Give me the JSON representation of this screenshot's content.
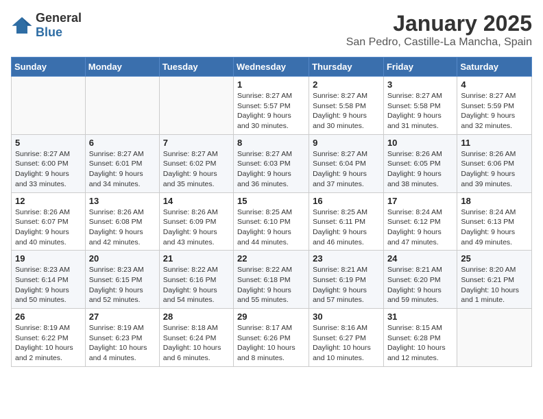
{
  "logo": {
    "general": "General",
    "blue": "Blue"
  },
  "header": {
    "month": "January 2025",
    "location": "San Pedro, Castille-La Mancha, Spain"
  },
  "weekdays": [
    "Sunday",
    "Monday",
    "Tuesday",
    "Wednesday",
    "Thursday",
    "Friday",
    "Saturday"
  ],
  "weeks": [
    [
      {
        "day": "",
        "info": ""
      },
      {
        "day": "",
        "info": ""
      },
      {
        "day": "",
        "info": ""
      },
      {
        "day": "1",
        "info": "Sunrise: 8:27 AM\nSunset: 5:57 PM\nDaylight: 9 hours\nand 30 minutes."
      },
      {
        "day": "2",
        "info": "Sunrise: 8:27 AM\nSunset: 5:58 PM\nDaylight: 9 hours\nand 30 minutes."
      },
      {
        "day": "3",
        "info": "Sunrise: 8:27 AM\nSunset: 5:58 PM\nDaylight: 9 hours\nand 31 minutes."
      },
      {
        "day": "4",
        "info": "Sunrise: 8:27 AM\nSunset: 5:59 PM\nDaylight: 9 hours\nand 32 minutes."
      }
    ],
    [
      {
        "day": "5",
        "info": "Sunrise: 8:27 AM\nSunset: 6:00 PM\nDaylight: 9 hours\nand 33 minutes."
      },
      {
        "day": "6",
        "info": "Sunrise: 8:27 AM\nSunset: 6:01 PM\nDaylight: 9 hours\nand 34 minutes."
      },
      {
        "day": "7",
        "info": "Sunrise: 8:27 AM\nSunset: 6:02 PM\nDaylight: 9 hours\nand 35 minutes."
      },
      {
        "day": "8",
        "info": "Sunrise: 8:27 AM\nSunset: 6:03 PM\nDaylight: 9 hours\nand 36 minutes."
      },
      {
        "day": "9",
        "info": "Sunrise: 8:27 AM\nSunset: 6:04 PM\nDaylight: 9 hours\nand 37 minutes."
      },
      {
        "day": "10",
        "info": "Sunrise: 8:26 AM\nSunset: 6:05 PM\nDaylight: 9 hours\nand 38 minutes."
      },
      {
        "day": "11",
        "info": "Sunrise: 8:26 AM\nSunset: 6:06 PM\nDaylight: 9 hours\nand 39 minutes."
      }
    ],
    [
      {
        "day": "12",
        "info": "Sunrise: 8:26 AM\nSunset: 6:07 PM\nDaylight: 9 hours\nand 40 minutes."
      },
      {
        "day": "13",
        "info": "Sunrise: 8:26 AM\nSunset: 6:08 PM\nDaylight: 9 hours\nand 42 minutes."
      },
      {
        "day": "14",
        "info": "Sunrise: 8:26 AM\nSunset: 6:09 PM\nDaylight: 9 hours\nand 43 minutes."
      },
      {
        "day": "15",
        "info": "Sunrise: 8:25 AM\nSunset: 6:10 PM\nDaylight: 9 hours\nand 44 minutes."
      },
      {
        "day": "16",
        "info": "Sunrise: 8:25 AM\nSunset: 6:11 PM\nDaylight: 9 hours\nand 46 minutes."
      },
      {
        "day": "17",
        "info": "Sunrise: 8:24 AM\nSunset: 6:12 PM\nDaylight: 9 hours\nand 47 minutes."
      },
      {
        "day": "18",
        "info": "Sunrise: 8:24 AM\nSunset: 6:13 PM\nDaylight: 9 hours\nand 49 minutes."
      }
    ],
    [
      {
        "day": "19",
        "info": "Sunrise: 8:23 AM\nSunset: 6:14 PM\nDaylight: 9 hours\nand 50 minutes."
      },
      {
        "day": "20",
        "info": "Sunrise: 8:23 AM\nSunset: 6:15 PM\nDaylight: 9 hours\nand 52 minutes."
      },
      {
        "day": "21",
        "info": "Sunrise: 8:22 AM\nSunset: 6:16 PM\nDaylight: 9 hours\nand 54 minutes."
      },
      {
        "day": "22",
        "info": "Sunrise: 8:22 AM\nSunset: 6:18 PM\nDaylight: 9 hours\nand 55 minutes."
      },
      {
        "day": "23",
        "info": "Sunrise: 8:21 AM\nSunset: 6:19 PM\nDaylight: 9 hours\nand 57 minutes."
      },
      {
        "day": "24",
        "info": "Sunrise: 8:21 AM\nSunset: 6:20 PM\nDaylight: 9 hours\nand 59 minutes."
      },
      {
        "day": "25",
        "info": "Sunrise: 8:20 AM\nSunset: 6:21 PM\nDaylight: 10 hours\nand 1 minute."
      }
    ],
    [
      {
        "day": "26",
        "info": "Sunrise: 8:19 AM\nSunset: 6:22 PM\nDaylight: 10 hours\nand 2 minutes."
      },
      {
        "day": "27",
        "info": "Sunrise: 8:19 AM\nSunset: 6:23 PM\nDaylight: 10 hours\nand 4 minutes."
      },
      {
        "day": "28",
        "info": "Sunrise: 8:18 AM\nSunset: 6:24 PM\nDaylight: 10 hours\nand 6 minutes."
      },
      {
        "day": "29",
        "info": "Sunrise: 8:17 AM\nSunset: 6:26 PM\nDaylight: 10 hours\nand 8 minutes."
      },
      {
        "day": "30",
        "info": "Sunrise: 8:16 AM\nSunset: 6:27 PM\nDaylight: 10 hours\nand 10 minutes."
      },
      {
        "day": "31",
        "info": "Sunrise: 8:15 AM\nSunset: 6:28 PM\nDaylight: 10 hours\nand 12 minutes."
      },
      {
        "day": "",
        "info": ""
      }
    ]
  ]
}
